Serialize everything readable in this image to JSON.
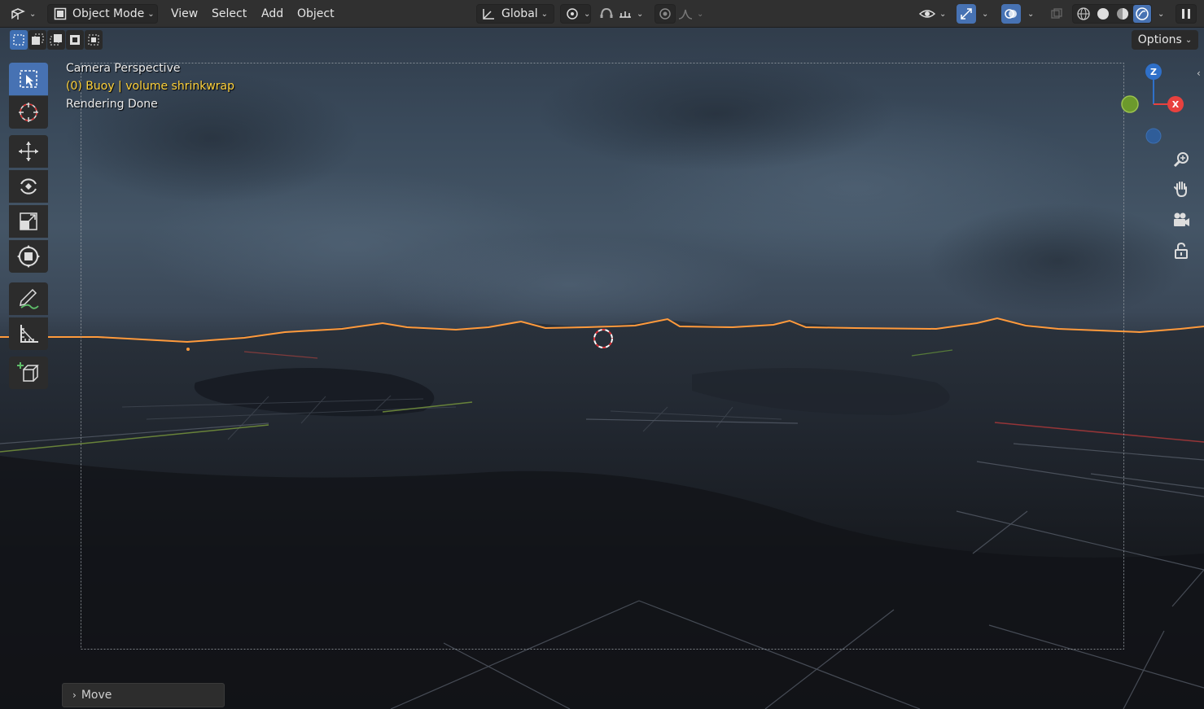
{
  "header": {
    "mode_label": "Object Mode",
    "menus": [
      "View",
      "Select",
      "Add",
      "Object"
    ],
    "transform_orientation": "Global",
    "options_label": "Options"
  },
  "overlay": {
    "view_name": "Camera Perspective",
    "object_info": "(0) Buoy | volume shrinkwrap",
    "status": "Rendering Done"
  },
  "gizmo": {
    "z_label": "Z",
    "x_label": "X"
  },
  "last_operator": {
    "label": "Move"
  },
  "colors": {
    "accent": "#4772b3",
    "selection_outline": "#ff9a3c",
    "overlay_yellow": "#ffd23a",
    "axis_x": "#e8413e",
    "axis_y": "#6c9a2c",
    "axis_z": "#2f70c9"
  },
  "icons": {
    "tools": [
      "select-box-icon",
      "cursor-icon",
      "move-icon",
      "rotate-icon",
      "scale-icon",
      "transform-icon",
      "annotate-icon",
      "measure-icon",
      "add-cube-icon"
    ],
    "nav": [
      "zoom-icon",
      "pan-hand-icon",
      "camera-view-icon",
      "lock-icon"
    ]
  }
}
